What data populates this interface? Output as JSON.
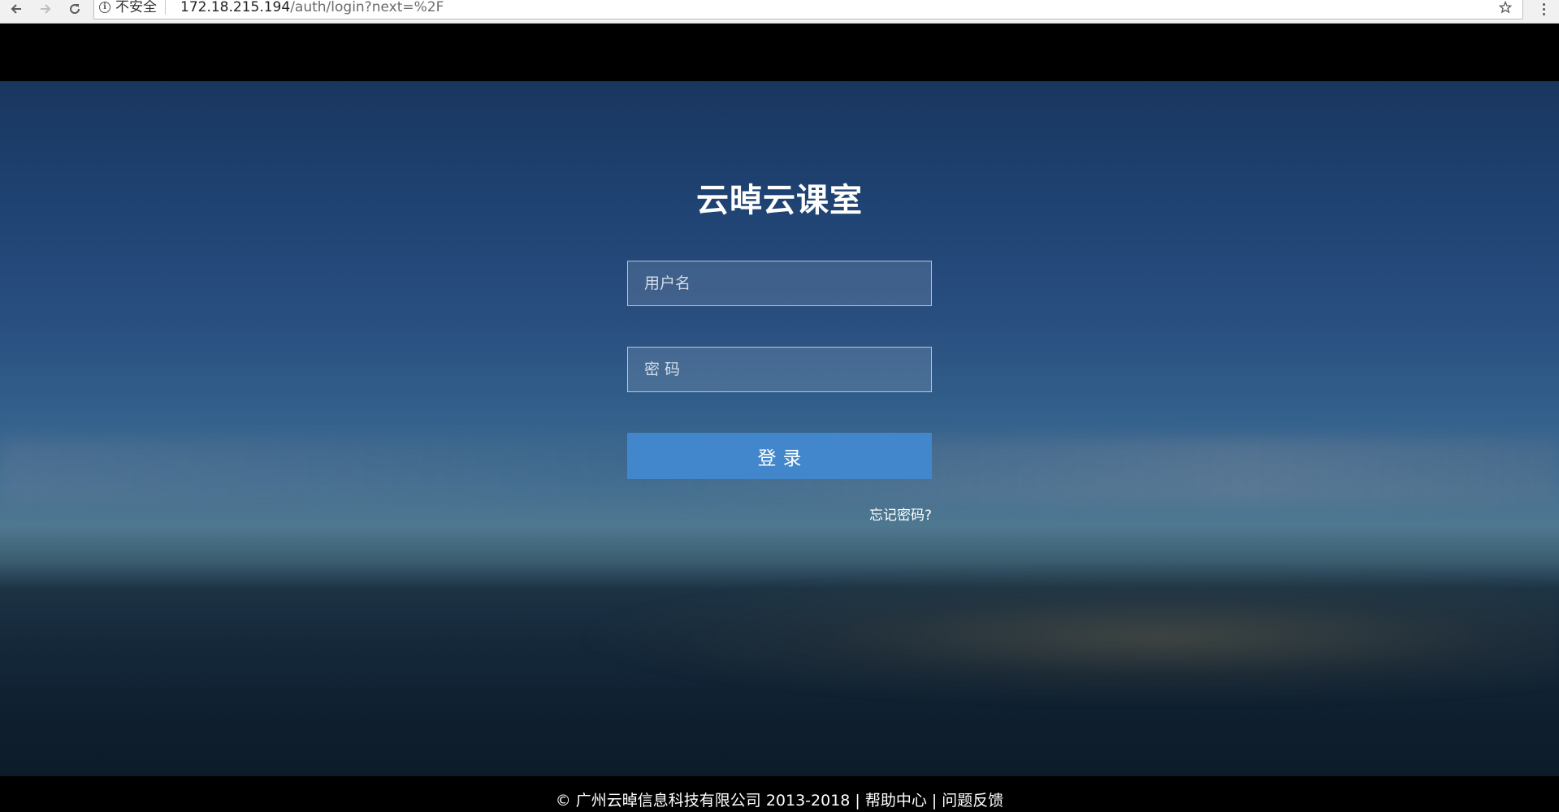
{
  "browser": {
    "security_label": "不安全",
    "url_host": "172.18.215.194",
    "url_path": "/auth/login?next=%2F"
  },
  "login": {
    "title": "云晫云课室",
    "username_placeholder": "用户名",
    "password_placeholder": "密码",
    "submit_label": "登录",
    "forgot_label": "忘记密码?"
  },
  "footer": {
    "copyright": "© 广州云晫信息科技有限公司 2013-2018",
    "separator": "|",
    "help_link": "帮助中心",
    "feedback_link": "问题反馈"
  },
  "colors": {
    "button": "#4287cb",
    "background": "#1f4373"
  },
  "icons": [
    "back-arrow-icon",
    "forward-arrow-icon",
    "reload-icon",
    "info-icon",
    "bookmark-star-icon",
    "menu-dots-icon"
  ]
}
